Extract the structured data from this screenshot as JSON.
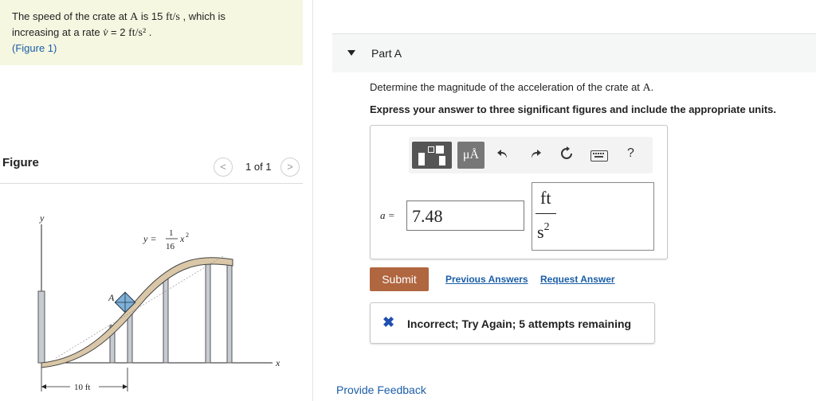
{
  "problem": {
    "line1_prefix": "The speed of the crate at ",
    "line1_point": "A",
    "line1_mid": " is 15 ",
    "line1_unit": "ft/s",
    "line1_suffix": " , which is",
    "line2_prefix": "increasing at a rate ",
    "line2_expr": "v̇",
    "line2_mid": " = 2 ",
    "line2_unit": "ft/s²",
    "line2_suffix": " .",
    "figure_link_open": "(",
    "figure_link": "Figure 1",
    "figure_link_close": ")"
  },
  "figure_panel": {
    "title": "Figure",
    "pager_prev": "<",
    "pager_text": "1 of 1",
    "pager_next": ">",
    "diagram": {
      "label_y": "y",
      "label_x": "x",
      "label_point": "A",
      "eq_lhs": "y =",
      "eq_num": "1",
      "eq_den": "16",
      "eq_var": "x",
      "eq_exp": "2",
      "dim_label": "10 ft"
    }
  },
  "part": {
    "label": "Part A",
    "question_prefix": "Determine the magnitude of the acceleration of the crate at ",
    "question_point": "A",
    "question_suffix": ".",
    "instructions": "Express your answer to three significant figures and include the appropriate units."
  },
  "toolbar": {
    "units_label": "μÅ",
    "undo_icon": "undo-icon",
    "redo_icon": "redo-icon",
    "reset_icon": "reset-icon",
    "keyboard_icon": "keyboard-icon",
    "help_label": "?"
  },
  "answer": {
    "variable": "a =",
    "value": "7.48",
    "unit_numerator": "ft",
    "unit_denominator": "s",
    "unit_exponent": "2"
  },
  "actions": {
    "submit": "Submit",
    "previous_answers": "Previous Answers",
    "request_answer": "Request Answer"
  },
  "feedback": {
    "icon": "✖",
    "message": "Incorrect; Try Again; 5 attempts remaining"
  },
  "footer": {
    "provide_feedback": "Provide Feedback"
  },
  "colors": {
    "problem_bg": "#f5f7e1",
    "link": "#1a5ea7",
    "submit_bg": "#b0663f",
    "incorrect_icon": "#1f4fb0"
  }
}
